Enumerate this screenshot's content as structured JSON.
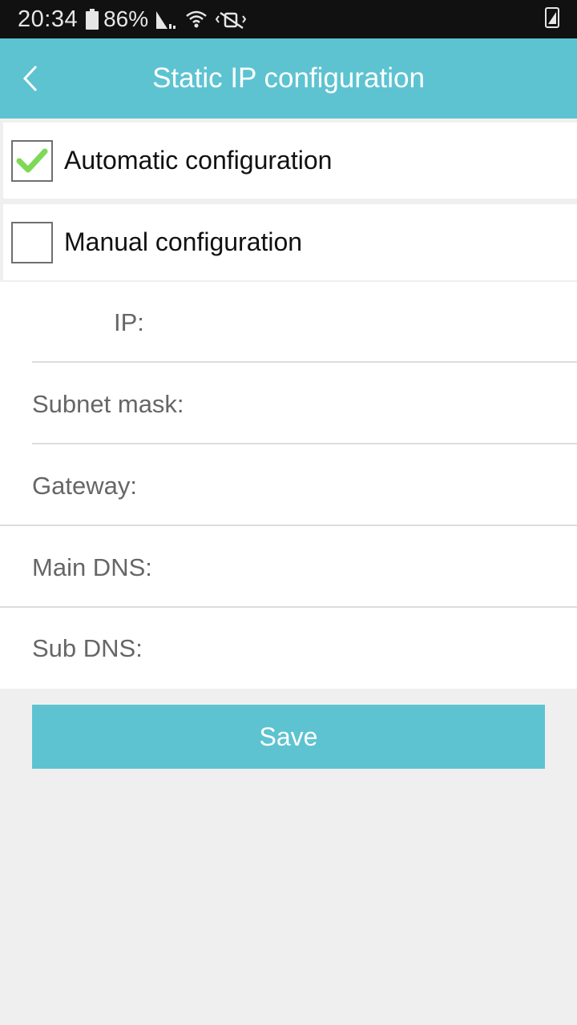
{
  "status_bar": {
    "time": "20:34",
    "battery_percent": "86%",
    "icons": [
      "battery-icon",
      "signal-icon",
      "wifi-icon",
      "mute-icon",
      "screen-rotation-icon"
    ]
  },
  "header": {
    "title": "Static IP configuration",
    "back_icon": "chevron-left-icon",
    "background_color": "#5dc3d1"
  },
  "options": [
    {
      "label": "Automatic configuration",
      "checked": true
    },
    {
      "label": "Manual configuration",
      "checked": false
    }
  ],
  "fields": [
    {
      "label": "IP:",
      "value": ""
    },
    {
      "label": "Subnet mask:",
      "value": ""
    },
    {
      "label": "Gateway:",
      "value": ""
    },
    {
      "label": "Main DNS:",
      "value": ""
    },
    {
      "label": "Sub DNS:",
      "value": ""
    }
  ],
  "actions": {
    "save_label": "Save"
  },
  "colors": {
    "accent": "#5dc3d1",
    "check": "#7ed957",
    "page_background": "#efefef"
  }
}
